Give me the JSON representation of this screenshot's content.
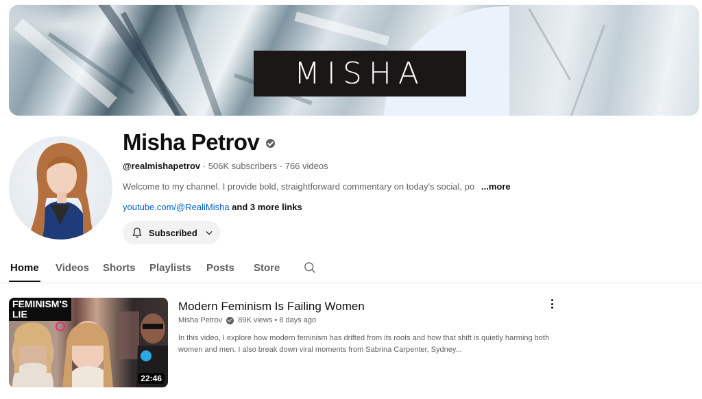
{
  "banner": {
    "logo_text": "MISHA"
  },
  "channel": {
    "name": "Misha Petrov",
    "handle": "@realmishapetrov",
    "subscribers": "506K subscribers",
    "videos": "766 videos",
    "description": "Welcome to my channel. I provide bold, straightforward commentary on today's social, po",
    "more_label": "...more",
    "link_text": "youtube.com/@RealiMisha",
    "more_links": "and 3 more links",
    "subscribe_label": "Subscribed"
  },
  "tabs": [
    {
      "label": "Home",
      "active": true
    },
    {
      "label": "Videos"
    },
    {
      "label": "Shorts"
    },
    {
      "label": "Playlists"
    },
    {
      "label": "Posts"
    },
    {
      "label": "Store"
    }
  ],
  "video": {
    "thumb_text_1": "FEMINISM'S",
    "thumb_text_2": "LIE",
    "duration": "22:46",
    "title": "Modern Feminism Is Failing Women",
    "channel": "Misha Petrov",
    "views": "89K views",
    "age": "8 days ago",
    "description": "In this video, I explore how modern feminism has drifted from its roots and how that shift is quietly harming both women and men. I also break down viral moments from Sabrina Carpenter, Sydney..."
  },
  "icons": {
    "verified": "verified-check-icon",
    "bell": "bell-icon",
    "chevron": "chevron-down-icon",
    "search": "search-icon",
    "more": "more-vert-icon"
  }
}
